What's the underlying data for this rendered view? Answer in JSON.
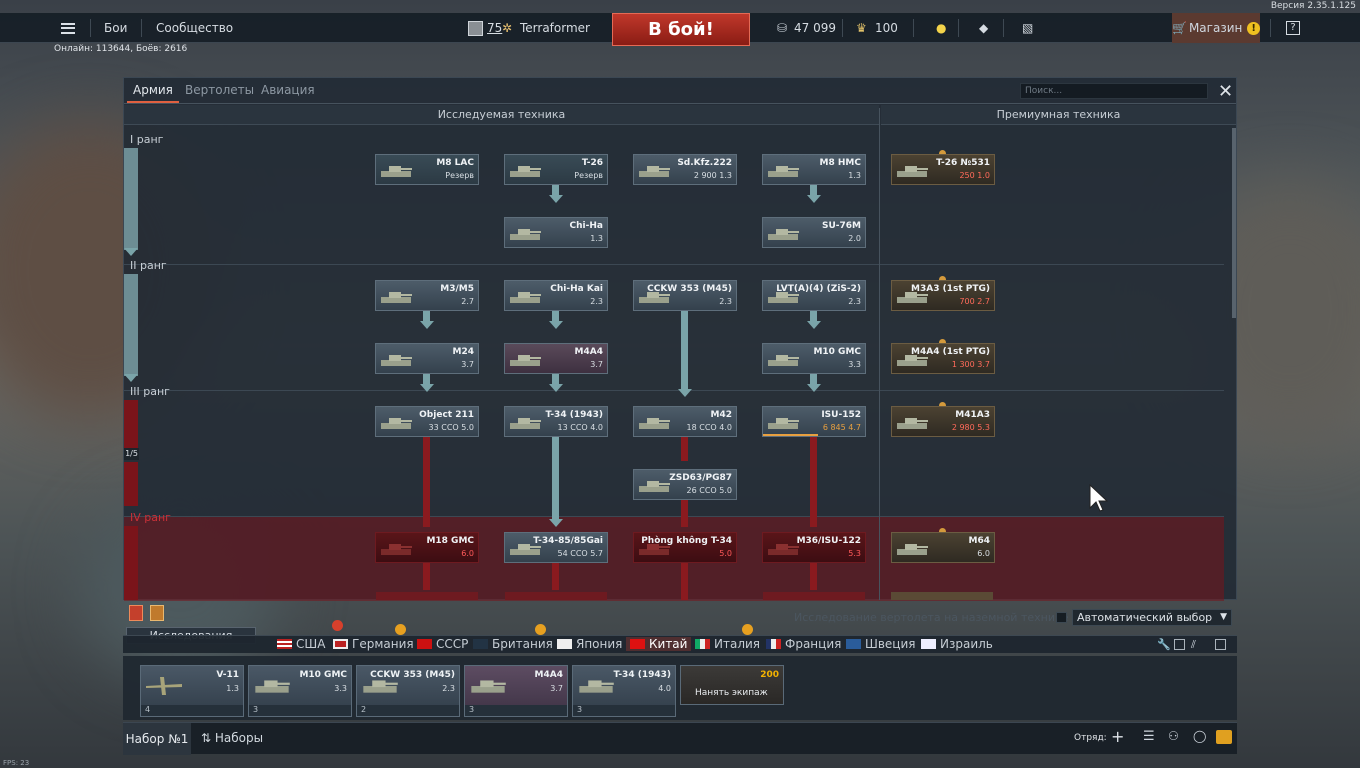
{
  "app": {
    "version": "Версия 2.35.1.125",
    "online": "Онлайн: 113644, Боёв: 2616",
    "fps": "FPS: 23"
  },
  "topbar": {
    "menu": [
      "Бои",
      "Сообщество"
    ],
    "player_level": "75",
    "player_name": "Terraformer",
    "battle_label": "В бой!",
    "silver": "47 099",
    "gold": "100",
    "shop_label": "Магазин"
  },
  "window": {
    "tabs": [
      "Армия",
      "Вертолеты",
      "Авиация"
    ],
    "search_placeholder": "Поиск...",
    "col_research": "Исследуемая техника",
    "col_premium": "Премиумная техника",
    "ranks": [
      "I ранг",
      "II ранг",
      "III ранг",
      "IV ранг"
    ],
    "rank_progress": "1/5",
    "helicopter_research_label": "Исследование вертолета на наземной технике",
    "auto_select": "Автоматический выбор"
  },
  "tree": {
    "research": [
      {
        "name": "M8 LAC",
        "stat": "Резерв"
      },
      {
        "name": "T-26",
        "stat": "Резерв"
      },
      {
        "name": "Sd.Kfz.222",
        "stat": "2 900 1.3"
      },
      {
        "name": "M8 HMC",
        "stat": "1.3"
      },
      {
        "name": "Chi-Ha",
        "stat": "1.3"
      },
      {
        "name": "SU-76M",
        "stat": "2.0"
      },
      {
        "name": "M3/M5",
        "stat": "2.7"
      },
      {
        "name": "Chi-Ha Kai",
        "stat": "2.3"
      },
      {
        "name": "CCKW 353 (M45)",
        "stat": "2.3"
      },
      {
        "name": "LVT(A)(4) (ZiS-2)",
        "stat": "2.3"
      },
      {
        "name": "M24",
        "stat": "3.7"
      },
      {
        "name": "M4A4",
        "stat": "3.7"
      },
      {
        "name": "M10 GMC",
        "stat": "3.3"
      },
      {
        "name": "Object 211",
        "stat": "33 CCO 5.0"
      },
      {
        "name": "T-34 (1943)",
        "stat": "13 CCO 4.0"
      },
      {
        "name": "M42",
        "stat": "18 CCO 4.0"
      },
      {
        "name": "ISU-152",
        "stat": "6 845 4.7"
      },
      {
        "name": "ZSD63/PG87",
        "stat": "26 CCO 5.0"
      },
      {
        "name": "M18 GMC",
        "stat": "6.0"
      },
      {
        "name": "T-34-85/85Gai",
        "stat": "54 CCO 5.7"
      },
      {
        "name": "Phòng không T-34",
        "stat": "5.0"
      },
      {
        "name": "M36/ISU-122",
        "stat": "5.3"
      }
    ],
    "premium": [
      {
        "name": "T-26 №531",
        "stat": "250 1.0"
      },
      {
        "name": "M3A3 (1st PTG)",
        "stat": "700 2.7"
      },
      {
        "name": "M4A4 (1st PTG)",
        "stat": "1 300 3.7"
      },
      {
        "name": "M41A3",
        "stat": "2 980 5.3"
      },
      {
        "name": "M64",
        "stat": "6.0"
      }
    ]
  },
  "research_label": "Исследования",
  "nations": [
    "США",
    "Германия",
    "СССР",
    "Британия",
    "Япония",
    "Китай",
    "Италия",
    "Франция",
    "Швеция",
    "Израиль"
  ],
  "crew": [
    {
      "name": "V-11",
      "stat": "1.3",
      "foot": "4"
    },
    {
      "name": "M10 GMC",
      "stat": "3.3",
      "foot": "3"
    },
    {
      "name": "CCKW 353 (M45)",
      "stat": "2.3",
      "foot": "2"
    },
    {
      "name": "M4A4",
      "stat": "3.7",
      "foot": "3"
    },
    {
      "name": "T-34 (1943)",
      "stat": "4.0",
      "foot": "3"
    },
    {
      "name": "Нанять экипаж",
      "stat": "200"
    }
  ],
  "bottom": {
    "preset": "Набор №1",
    "presets": "Наборы",
    "squad": "Отряд:"
  },
  "colors": {
    "accent": "#e06040",
    "battle": "#b0352a",
    "locked": "#5a1519",
    "premium": "#4c4232"
  }
}
